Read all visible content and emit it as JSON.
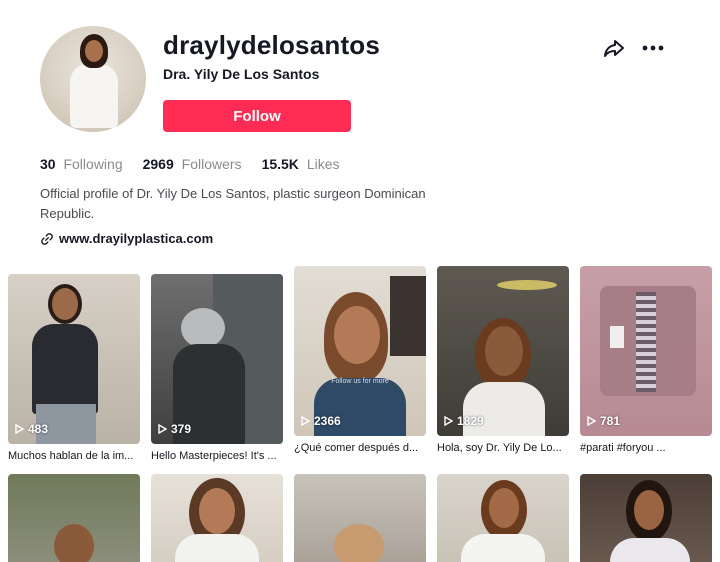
{
  "profile": {
    "username": "draylydelosantos",
    "nickname": "Dra. Yily De Los Santos",
    "follow_label": "Follow"
  },
  "stats": {
    "following_count": "30",
    "following_label": "Following",
    "followers_count": "2969",
    "followers_label": "Followers",
    "likes_count": "15.5K",
    "likes_label": "Likes"
  },
  "bio": "Official profile of Dr. Yily De Los Santos, plastic surgeon Dominican Republic.",
  "link": "www.drayilyplastica.com",
  "videos": [
    {
      "views": "483",
      "caption": "Muchos hablan de la im..."
    },
    {
      "views": "379",
      "caption": "Hello Masterpieces! It's ..."
    },
    {
      "views": "2366",
      "caption": "¿Qué comer después d...",
      "overlay": "Follow us for more"
    },
    {
      "views": "1829",
      "caption": "Hola, soy Dr. Yily De Lo..."
    },
    {
      "views": "781",
      "caption": "#parati #foryou ..."
    }
  ],
  "icons": {
    "share": "share-icon",
    "more": "more-icon",
    "link": "link-icon",
    "play": "play-icon"
  },
  "colors": {
    "accent": "#fe2c55",
    "text": "#161823",
    "muted": "#8a8b91"
  }
}
